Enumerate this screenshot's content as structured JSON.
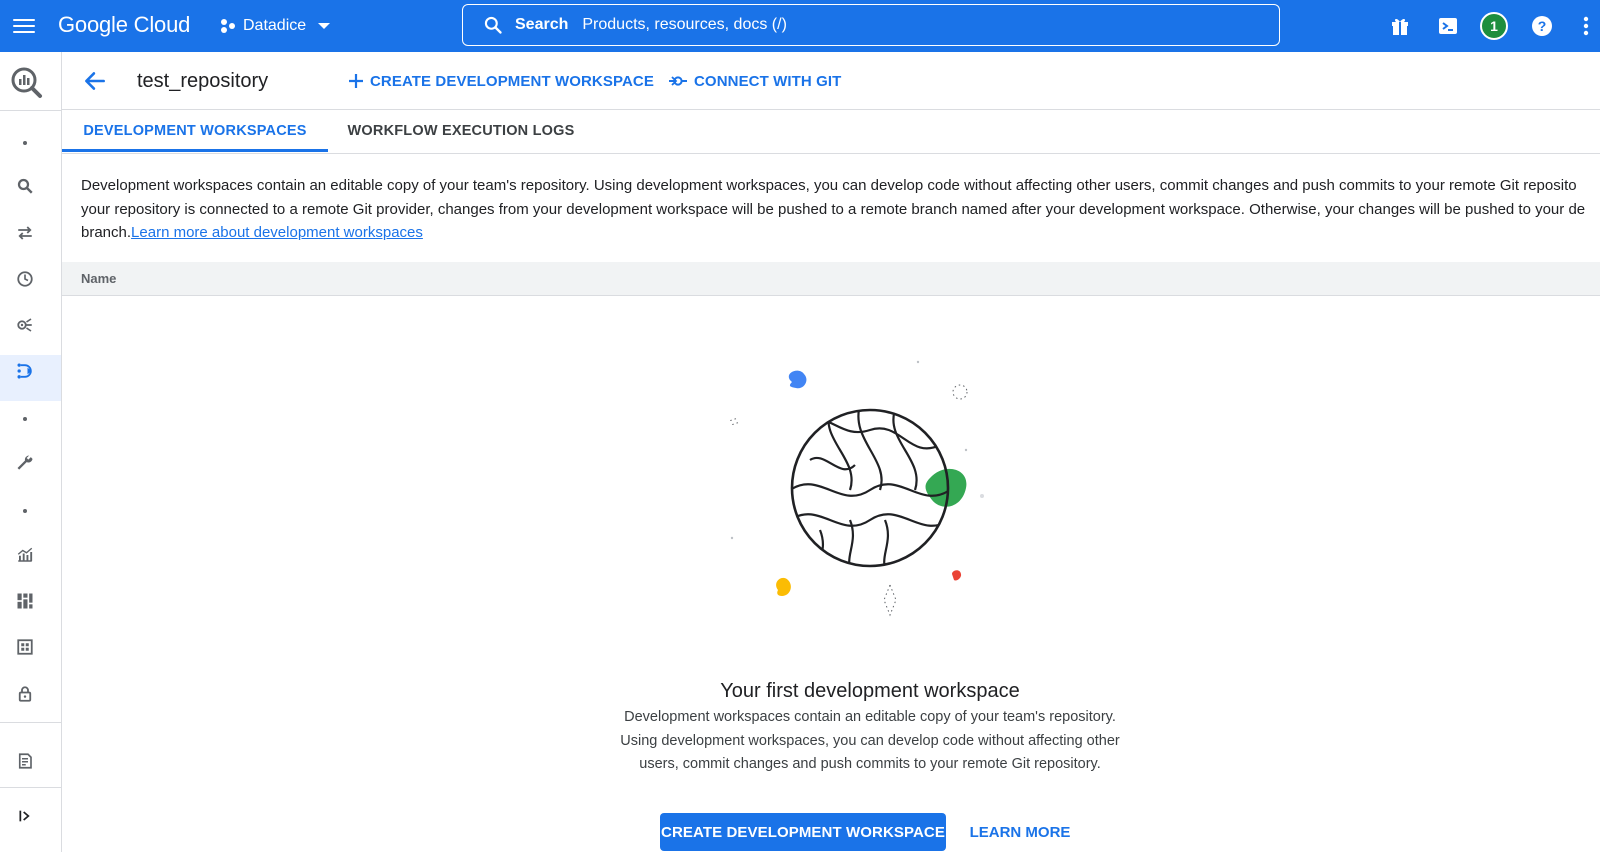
{
  "topbar": {
    "brand": "Google Cloud",
    "project": "Datadice",
    "search_label": "Search",
    "search_placeholder": "Products, resources, docs (/)",
    "notification_count": "1"
  },
  "header": {
    "repo_name": "test_repository",
    "create_workspace_label": "CREATE DEVELOPMENT WORKSPACE",
    "connect_git_label": "CONNECT WITH GIT"
  },
  "tabs": [
    {
      "label": "DEVELOPMENT WORKSPACES",
      "active": true
    },
    {
      "label": "WORKFLOW EXECUTION LOGS",
      "active": false
    }
  ],
  "description": {
    "line1": "Development workspaces contain an editable copy of your team's repository. Using development workspaces, you can develop code without affecting other users, commit changes and push commits to your remote Git reposito",
    "line2": "your repository is connected to a remote Git provider, changes from your development workspace will be pushed to a remote branch named after your development workspace. Otherwise, your changes will be pushed to your de",
    "line3_prefix": "branch.",
    "link": "Learn more about development workspaces"
  },
  "table": {
    "columns": [
      "Name"
    ]
  },
  "empty_state": {
    "title": "Your first development workspace",
    "body_lines": [
      "Development workspaces contain an editable copy of your team's repository.",
      "Using development workspaces, you can develop code without affecting other",
      "users, commit changes and push commits to your remote Git repository."
    ],
    "primary_button": "CREATE DEVELOPMENT WORKSPACE",
    "secondary_button": "LEARN MORE"
  },
  "colors": {
    "brand_blue": "#1a73e8",
    "badge_green": "#1e8e3e",
    "illustration_blue": "#4285f4",
    "illustration_green": "#34a853",
    "illustration_yellow": "#fbbc04",
    "illustration_red": "#ea4335"
  },
  "icons": {
    "topbar": [
      "menu-icon",
      "project-icon",
      "search-icon",
      "gift-icon",
      "cloud-shell-icon",
      "help-icon",
      "more-vert-icon"
    ],
    "rail": [
      "bigquery-icon",
      "search-icon",
      "transfers-icon",
      "schedule-icon",
      "analytics-hub-icon",
      "dataform-icon",
      "wrench-icon",
      "monitoring-icon",
      "dashboard-icon",
      "table-icon",
      "lock-icon",
      "release-notes-icon",
      "expand-icon"
    ]
  }
}
